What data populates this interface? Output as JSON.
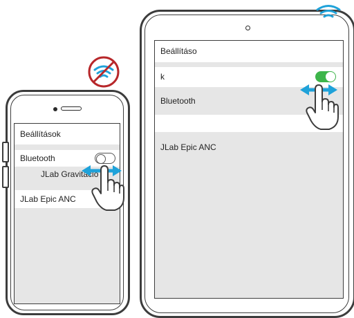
{
  "phone": {
    "title": "Beállítások",
    "bluetooth_label": "Bluetooth",
    "device_connected": "JLab Gravitáció",
    "device_other": "JLab Epic ANC",
    "bluetooth_toggle_on": false,
    "wifi_status": "disabled"
  },
  "tablet": {
    "title_part1": "Beállításo",
    "title_part2": "k",
    "bluetooth_label": "Bluetooth",
    "device_other": "JLab Epic ANC",
    "bluetooth_toggle_on": true,
    "wifi_status": "enabled"
  },
  "colors": {
    "accent_blue": "#1fa2d9",
    "toggle_green": "#3db54a",
    "no_sign_red": "#b7272a",
    "outline": "#3c3c3c",
    "screen_grey": "#e6e6e6"
  },
  "icons": [
    "wifi-off-icon",
    "wifi-icon",
    "hand-pointer-icon",
    "swipe-arrows-icon"
  ]
}
